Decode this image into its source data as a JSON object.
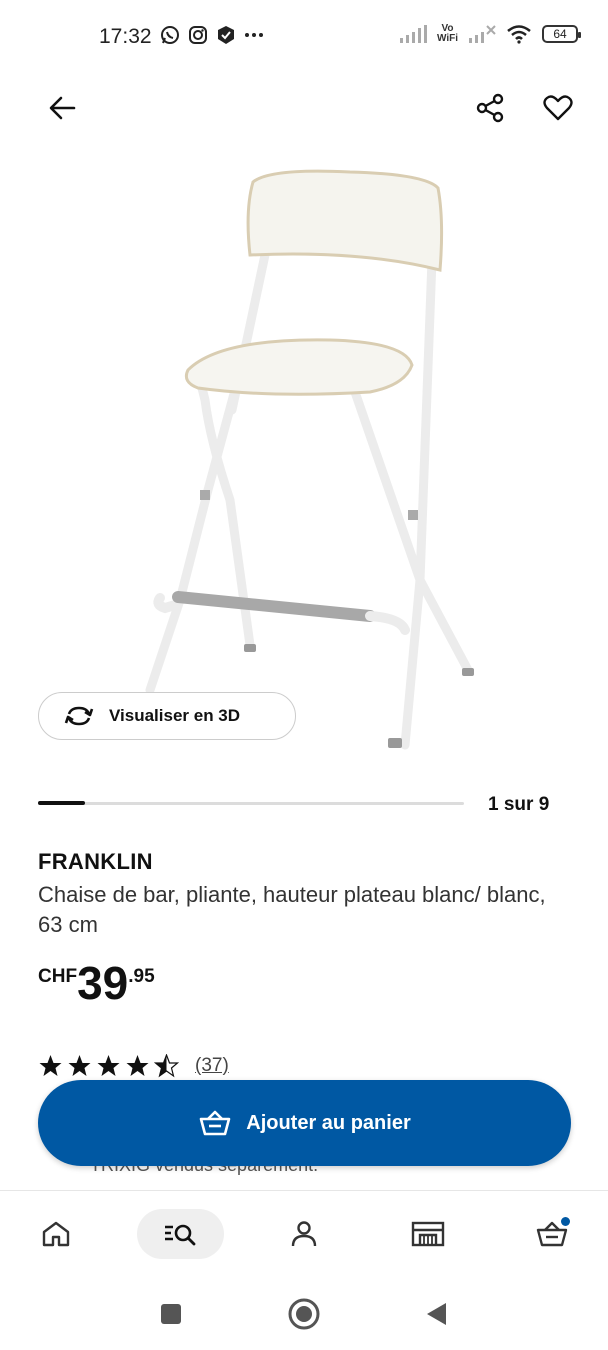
{
  "status_bar": {
    "time": "17:32",
    "left_icons": [
      "whatsapp-icon",
      "instagram-icon",
      "shield-app-icon",
      "more-dots-icon"
    ],
    "vowifi_top": "Vo",
    "vowifi_bottom": "WiFi",
    "battery": "64"
  },
  "product": {
    "name": "FRANKLIN",
    "description": "Chaise de bar, pliante, hauteur plateau blanc/ blanc, 63 cm",
    "price_currency": "CHF",
    "price_integer": "39",
    "price_decimal": ".95",
    "rating": 4.5,
    "rating_count": "(37)",
    "image_subject": "white folding bar stool"
  },
  "viewer": {
    "visualize_label": "Visualiser en 3D",
    "page_indicator": "1 sur 9",
    "current_page": 1,
    "total_pages": 9
  },
  "cart": {
    "add_label": "Ajouter au panier",
    "behind_note": "TRIXIG vendus séparément."
  },
  "colors": {
    "primary": "#0058a3",
    "text": "#111111"
  }
}
